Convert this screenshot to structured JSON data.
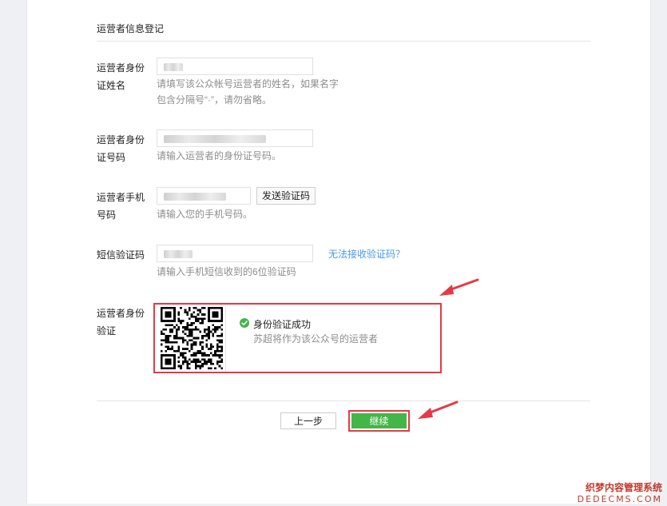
{
  "section": {
    "title": "运营者信息登记"
  },
  "fields": {
    "name": {
      "label_line1": "运营者身份",
      "label_line2": "证姓名",
      "hint_line1": "请填写该公众帐号运营者的姓名，如果名字",
      "hint_line2": "包含分隔号“·”，请勿省略。"
    },
    "id_number": {
      "label_line1": "运营者身份",
      "label_line2": "证号码",
      "hint": "请输入运营者的身份证号码。"
    },
    "phone": {
      "label_line1": "运营者手机",
      "label_line2": "号码",
      "hint": "请输入您的手机号码。",
      "send_code_label": "发送验证码"
    },
    "sms": {
      "label": "短信验证码",
      "hint": "请输入手机短信收到的6位验证码",
      "help_link": "无法接收验证码？"
    },
    "identity": {
      "label_line1": "运营者身份",
      "label_line2": "验证",
      "success_title": "身份验证成功",
      "success_sub": "苏超将作为该公众号的运营者"
    }
  },
  "actions": {
    "prev_label": "上一步",
    "next_label": "继续"
  },
  "icons": {
    "success": "check-circle-icon",
    "qr": "qr-code-icon",
    "annotation": "red-arrow-icon"
  },
  "colors": {
    "primary": "#44b549",
    "link": "#459ae9",
    "highlight": "#e63946"
  },
  "watermark": {
    "line1": "织梦内容管理系统",
    "line2": "DEDECMS.COM"
  }
}
